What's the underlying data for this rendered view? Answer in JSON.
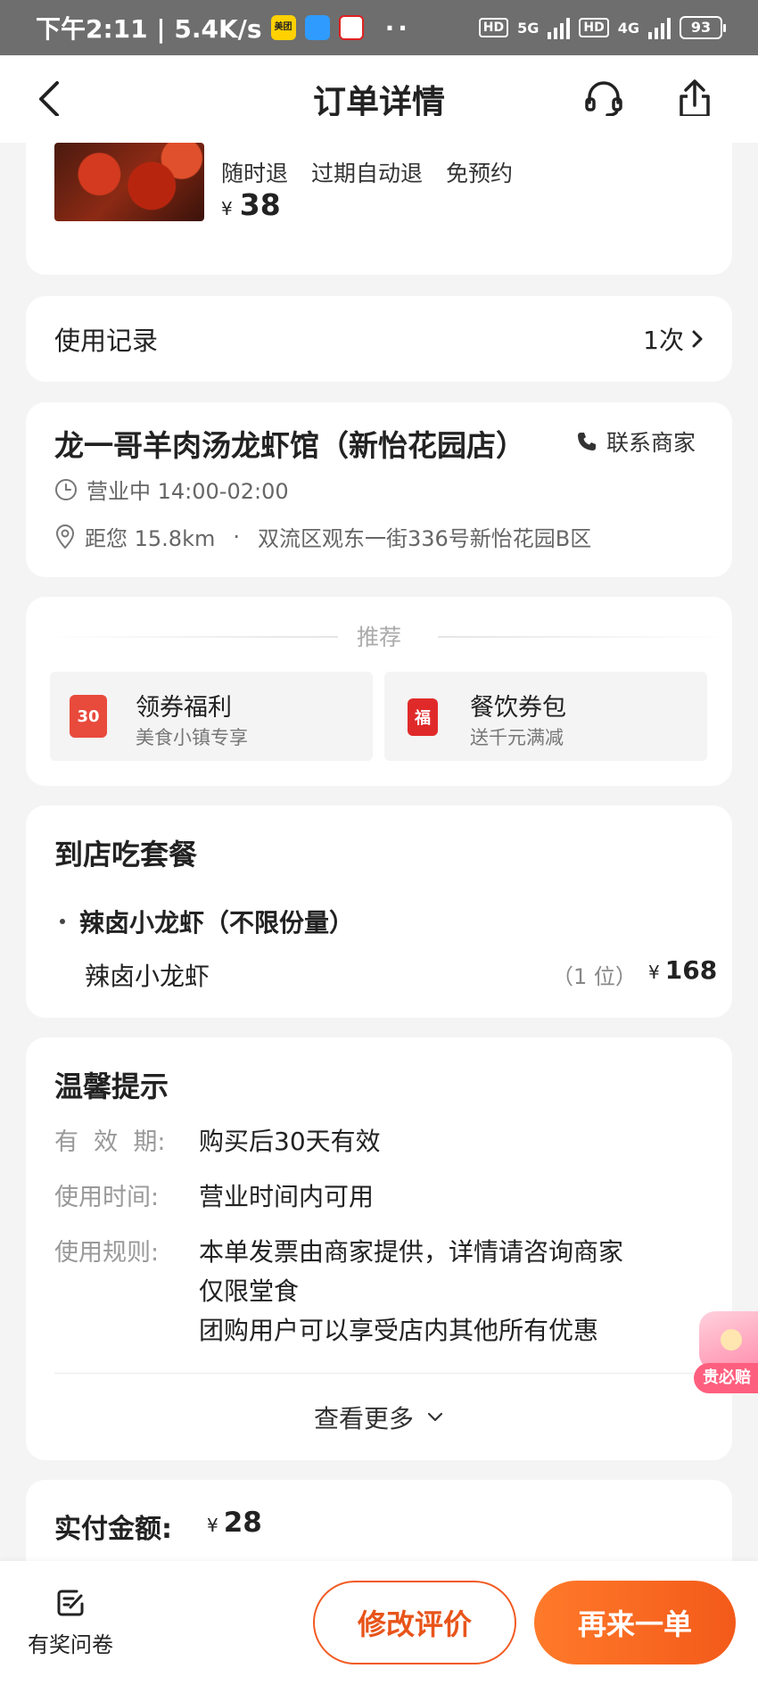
{
  "status_bar": {
    "time_speed": "下午2:11 | 5.4K/s",
    "apps": [
      "美团",
      "app",
      "支付"
    ],
    "dots": "··",
    "hd1": "HD",
    "net1": "5G",
    "hd2": "HD",
    "net2": "4G",
    "battery": "93"
  },
  "header": {
    "title": "订单详情",
    "icons": [
      "back-icon",
      "headset-icon",
      "share-icon"
    ]
  },
  "product": {
    "tags": [
      "随时退",
      "过期自动退",
      "免预约"
    ],
    "currency": "¥",
    "price": "38"
  },
  "usage": {
    "label": "使用记录",
    "count": "1次"
  },
  "store": {
    "name": "龙一哥羊肉汤龙虾馆（新怡花园店）",
    "contact": "联系商家",
    "hours": "营业中 14:00-02:00",
    "distance": "距您 15.8km",
    "separator": "·",
    "address": "双流区观东一街336号新怡花园B区"
  },
  "recommend": {
    "title": "推荐",
    "items": [
      {
        "icon_text": "30",
        "title": "领券福利",
        "subtitle": "美食小镇专享"
      },
      {
        "icon_text": "福",
        "title": "餐饮券包",
        "subtitle": "送千元满减"
      }
    ]
  },
  "package": {
    "title": "到店吃套餐",
    "item": "辣卤小龙虾（不限份量）",
    "sub_item": "辣卤小龙虾",
    "qty": "（1 位）",
    "currency": "¥",
    "price": "168"
  },
  "tips": {
    "title": "温馨提示",
    "rows": [
      {
        "label": "有  效  期:",
        "value": "购买后30天有效"
      },
      {
        "label": "使用时间:",
        "value": "营业时间内可用"
      },
      {
        "label": "使用规则:",
        "value": "本单发票由商家提供，详情请咨询商家"
      }
    ],
    "extra_rules": [
      "仅限堂食",
      "团购用户可以享受店内其他所有优惠"
    ],
    "more": "查看更多"
  },
  "paid": {
    "label": "实付金额:",
    "currency": "¥",
    "amount": "28"
  },
  "floating": {
    "label": "贵必赔"
  },
  "bottom": {
    "survey": "有奖问卷",
    "review_button": "修改评价",
    "again_button": "再来一单"
  },
  "colors": {
    "accent": "#f35a1a",
    "accent_light": "#ff7a2a",
    "background": "#f4f4f4"
  }
}
